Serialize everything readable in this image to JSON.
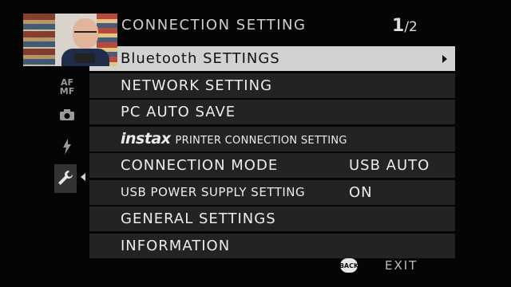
{
  "header": {
    "title": "CONNECTION SETTING",
    "page_current": "1",
    "page_total": "/2"
  },
  "sidebar": {
    "tabs": [
      {
        "name": "af-mf",
        "label": "AF\nMF"
      },
      {
        "name": "camera",
        "icon": "camera-icon"
      },
      {
        "name": "flash",
        "icon": "flash-icon"
      },
      {
        "name": "setup",
        "icon": "wrench-icon",
        "active": true
      }
    ]
  },
  "menu": {
    "items": [
      {
        "label": "Bluetooth SETTINGS",
        "value": "",
        "selected": true
      },
      {
        "label": "NETWORK SETTING",
        "value": ""
      },
      {
        "label": "PC AUTO SAVE",
        "value": ""
      },
      {
        "label_brand": "instax",
        "label": "PRINTER CONNECTION SETTING",
        "value": ""
      },
      {
        "label": "CONNECTION MODE",
        "value": "USB AUTO"
      },
      {
        "label": "USB POWER SUPPLY SETTING",
        "value": "ON"
      },
      {
        "label": "GENERAL SETTINGS",
        "value": ""
      },
      {
        "label": "INFORMATION",
        "value": ""
      }
    ]
  },
  "footer": {
    "back_label": "BACK",
    "exit_label": "EXIT"
  },
  "colors": {
    "background": "#050505",
    "row": "#232323",
    "selected_row": "#d2d2d2",
    "text": "#ececec"
  }
}
